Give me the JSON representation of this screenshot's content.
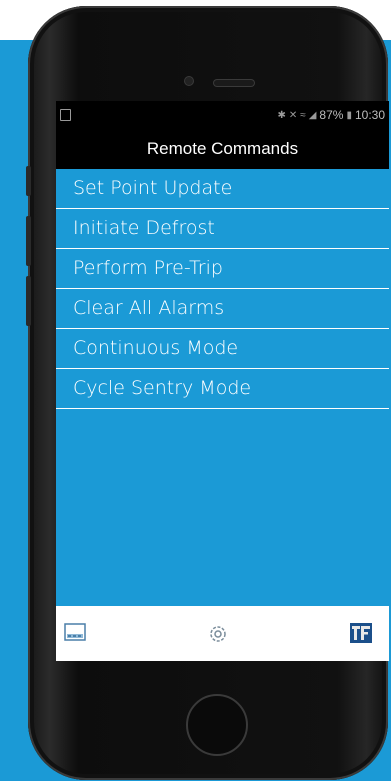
{
  "status_bar": {
    "battery": "87%",
    "time": "10:30"
  },
  "header": {
    "title": "Remote Commands"
  },
  "commands": [
    {
      "label": "Set Point Update"
    },
    {
      "label": "Initiate Defrost"
    },
    {
      "label": "Perform Pre-Trip"
    },
    {
      "label": "Clear All Alarms"
    },
    {
      "label": "Continuous Mode"
    },
    {
      "label": "Cycle Sentry Mode"
    }
  ],
  "tab_bar": {
    "icons": [
      "dashboard-icon",
      "settings-gear-icon",
      "brand-logo-icon"
    ]
  },
  "colors": {
    "accent": "#1b9ad6",
    "header_bg": "#000000",
    "item_text": "#ffffff"
  }
}
